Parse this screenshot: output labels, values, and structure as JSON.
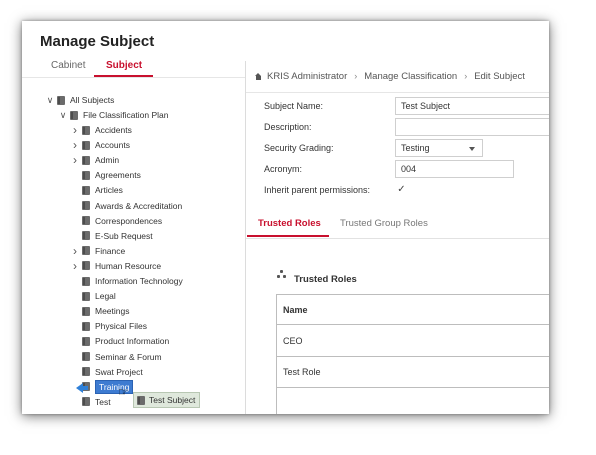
{
  "page_title": "Manage Subject",
  "tabs": {
    "cabinet": "Cabinet",
    "subject": "Subject"
  },
  "tree": {
    "root": "All Subjects",
    "plan": "File Classification Plan",
    "items": [
      {
        "label": "Accidents",
        "expandable": true
      },
      {
        "label": "Accounts",
        "expandable": true
      },
      {
        "label": "Admin",
        "expandable": true
      },
      {
        "label": "Agreements",
        "expandable": false
      },
      {
        "label": "Articles",
        "expandable": false
      },
      {
        "label": "Awards & Accreditation",
        "expandable": false
      },
      {
        "label": "Correspondences",
        "expandable": false
      },
      {
        "label": "E-Sub Request",
        "expandable": false
      },
      {
        "label": "Finance",
        "expandable": true
      },
      {
        "label": "Human Resource",
        "expandable": true
      },
      {
        "label": "Information Technology",
        "expandable": false
      },
      {
        "label": "Legal",
        "expandable": false
      },
      {
        "label": "Meetings",
        "expandable": false
      },
      {
        "label": "Physical Files",
        "expandable": false
      },
      {
        "label": "Product Information",
        "expandable": false
      },
      {
        "label": "Seminar & Forum",
        "expandable": false
      },
      {
        "label": "Swat Project",
        "expandable": false
      },
      {
        "label": "Training",
        "expandable": false,
        "selected": true
      },
      {
        "label": "Test",
        "expandable": false
      }
    ],
    "drag_ghost_label": "Test Subject"
  },
  "breadcrumb": [
    "KRIS Administrator",
    "Manage Classification",
    "Edit Subject"
  ],
  "form": {
    "subject_name_label": "Subject Name:",
    "subject_name_value": "Test Subject",
    "description_label": "Description:",
    "description_value": "",
    "security_grading_label": "Security Grading:",
    "security_grading_value": "Testing",
    "acronym_label": "Acronym:",
    "acronym_value": "004",
    "inherit_label": "Inherit parent permissions:",
    "inherit_checked": true
  },
  "roles_tabs": {
    "trusted_roles": "Trusted Roles",
    "trusted_group_roles": "Trusted Group Roles"
  },
  "trusted_roles_heading": "Trusted Roles",
  "roles_table": {
    "header": "Name",
    "rows": [
      "CEO",
      "Test Role",
      ""
    ]
  },
  "colors": {
    "accent": "#c8102e",
    "selection": "#3d7bd1"
  }
}
